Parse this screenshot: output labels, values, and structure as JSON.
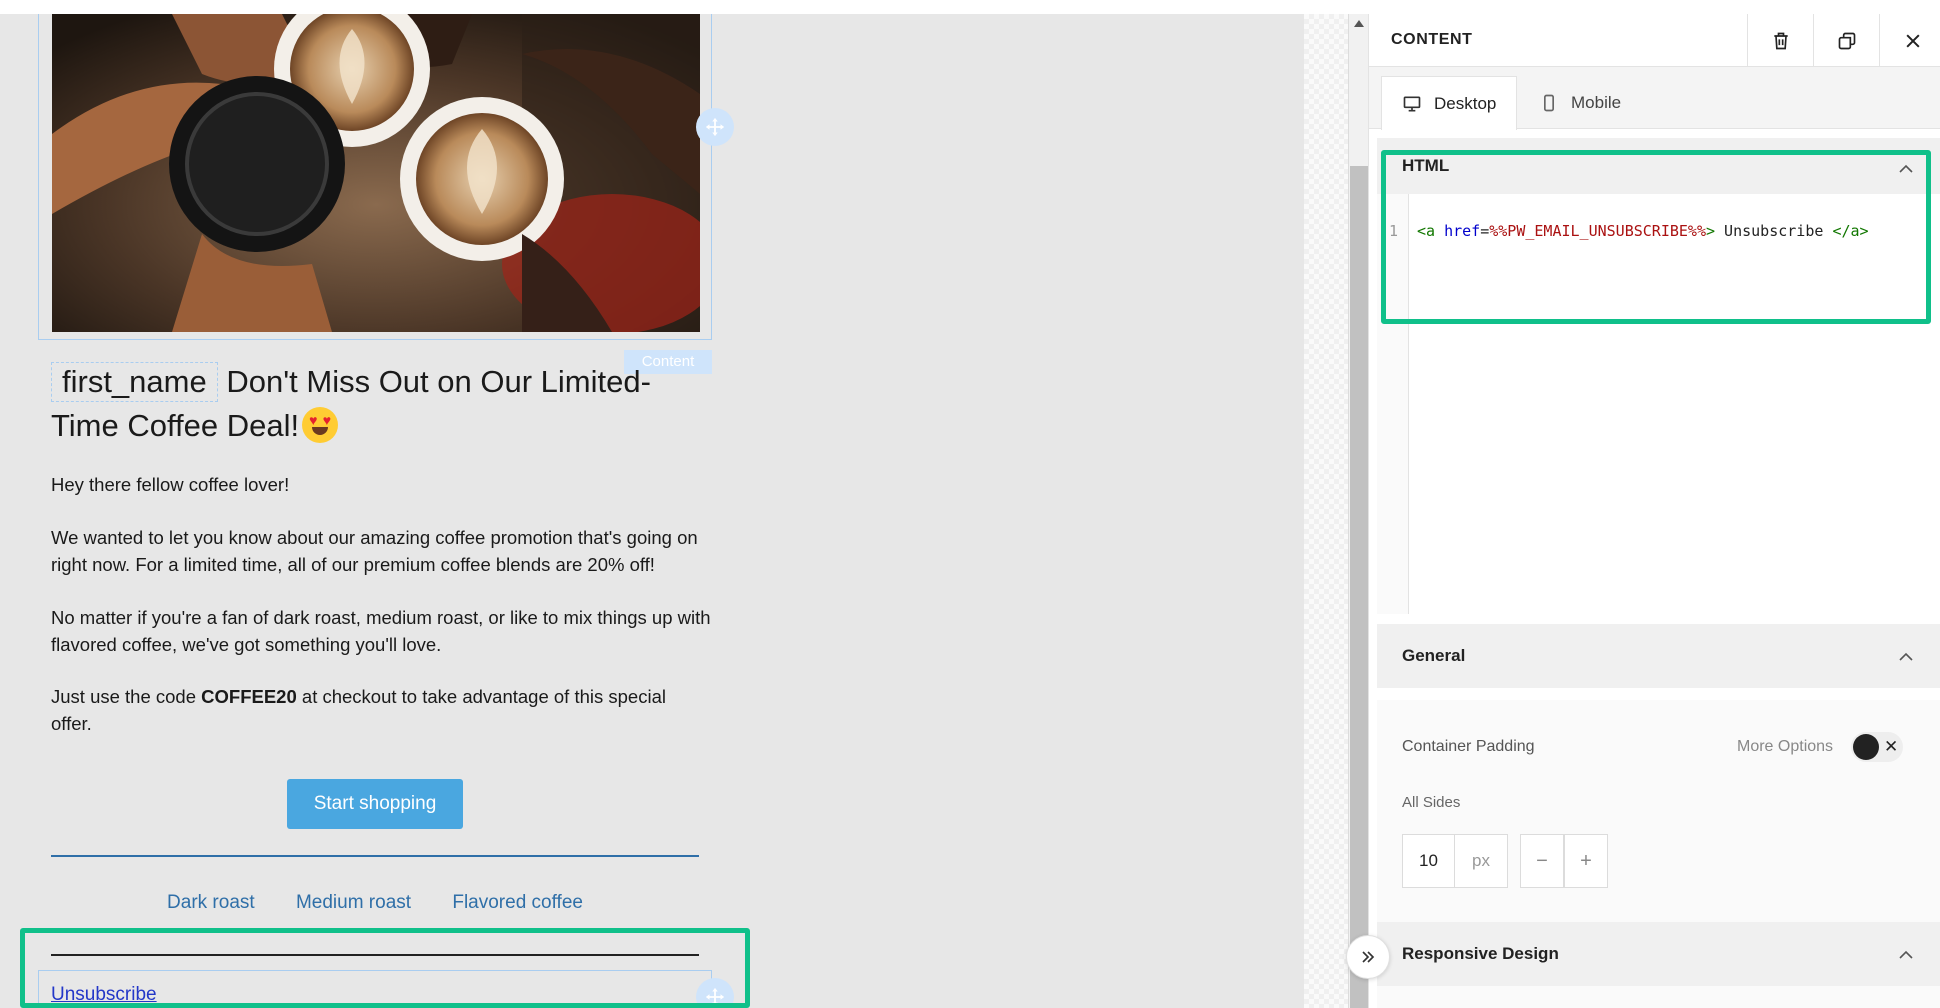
{
  "editor": {
    "content_tag": "Content",
    "headline": {
      "merge_tag": "first_name",
      "text": "Don't Miss Out on Our Limited-Time Coffee Deal!"
    },
    "paragraphs": {
      "p1": "Hey there fellow coffee lover!",
      "p2": "We wanted to let you know about our amazing coffee promotion that's going on right now. For a limited time, all of our premium coffee blends are 20% off!",
      "p3": "No matter if you're a fan of dark roast, medium roast, or like to mix things up with flavored coffee, we've got something you'll love.",
      "p4_before": "Just use the code ",
      "p4_code": "COFFEE20",
      "p4_after": " at checkout to take advantage of this special offer."
    },
    "cta_label": "Start shopping",
    "footer_links": [
      "Dark roast",
      "Medium roast",
      "Flavored coffee"
    ],
    "unsubscribe_label": "Unsubscribe"
  },
  "panel": {
    "title": "CONTENT",
    "tabs": [
      "Desktop",
      "Mobile"
    ],
    "html_section": {
      "title": "HTML",
      "line_number": "1",
      "code": {
        "open_tag": "<a",
        "attr": "href",
        "equals": "=",
        "value": "%%PW_EMAIL_UNSUBSCRIBE%%",
        "close_bracket": ">",
        "text": " Unsubscribe ",
        "close_tag": "</a>"
      }
    },
    "general": {
      "title": "General",
      "container_padding_label": "Container Padding",
      "more_options_label": "More Options",
      "all_sides_label": "All Sides",
      "padding_value": "10",
      "padding_unit": "px",
      "minus": "−",
      "plus": "+",
      "toggle_x": "✕"
    },
    "responsive_title": "Responsive Design"
  },
  "colors": {
    "highlight": "#10c08a",
    "cta": "#4aa7e0",
    "link": "#2f6fa8",
    "unsubscribe": "#2337c8"
  }
}
